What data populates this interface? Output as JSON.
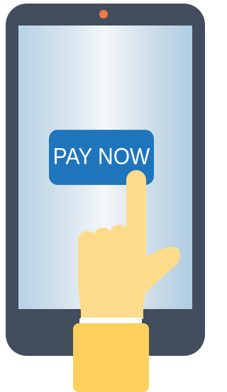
{
  "payment": {
    "button_label": "PAY NOW"
  },
  "icons": {
    "phone": "smartphone-icon",
    "camera": "camera-dot-icon",
    "hand": "pointing-hand-icon"
  },
  "colors": {
    "phone_body": "#424d5d",
    "camera_dot": "#f07a41",
    "screen_light": "#f4f7f9",
    "screen_edge": "#b7d3e7",
    "button": "#1f75bc",
    "button_text": "#ffffff",
    "skin": "#fcdc8b",
    "sleeve": "#fdd05d",
    "cuff": "#ffffff"
  }
}
